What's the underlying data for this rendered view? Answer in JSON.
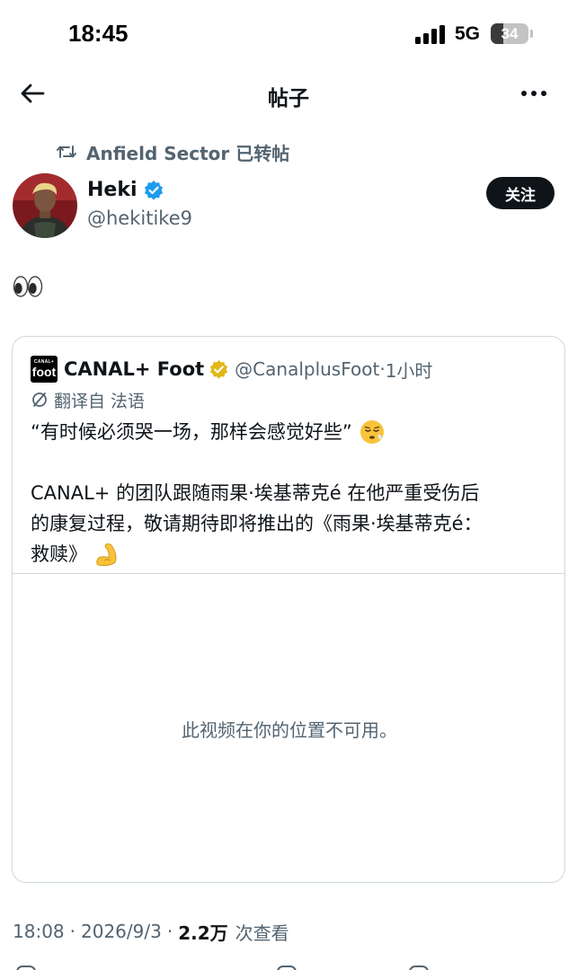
{
  "status_bar": {
    "time": "18:45",
    "network": "5G",
    "battery_level": 34,
    "battery_text": "34"
  },
  "nav": {
    "title": "帖子",
    "back_icon": "arrow-left-icon",
    "more_icon": "more-horizontal-icon"
  },
  "repost": {
    "text": "Anfield Sector 已转帖",
    "icon": "repost-icon"
  },
  "author": {
    "name": "Heki",
    "handle": "@hekitike9",
    "verified": true,
    "follow_label": "关注"
  },
  "post": {
    "body": "👀"
  },
  "quote": {
    "logo_top": "CANAL+",
    "logo_text": "foot",
    "name": "CANAL+ Foot",
    "handle": "@CanalplusFoot",
    "separator": "·",
    "time": "1小时",
    "translation_label": "翻译自 法语",
    "text_line1": "“有时候必须哭一场，那样会感觉好些”",
    "text_line2": "CANAL+ 的团队跟随雨果·埃基蒂克é 在他严重受伤后",
    "text_line3": "的康复过程，敬请期待即将推出的《雨果·埃基蒂克é：",
    "text_line4": "救赎》",
    "media_unavailable": "此视频在你的位置不可用。"
  },
  "meta": {
    "time": "18:08",
    "dot": "·",
    "date": "2026/9/3",
    "views": "2.2万",
    "views_label": "次查看"
  },
  "colors": {
    "text": "#0f1419",
    "secondary": "#536471",
    "border": "#cfd9de",
    "verified_blue": "#1d9bf0",
    "verified_gold": "#e2b719"
  }
}
